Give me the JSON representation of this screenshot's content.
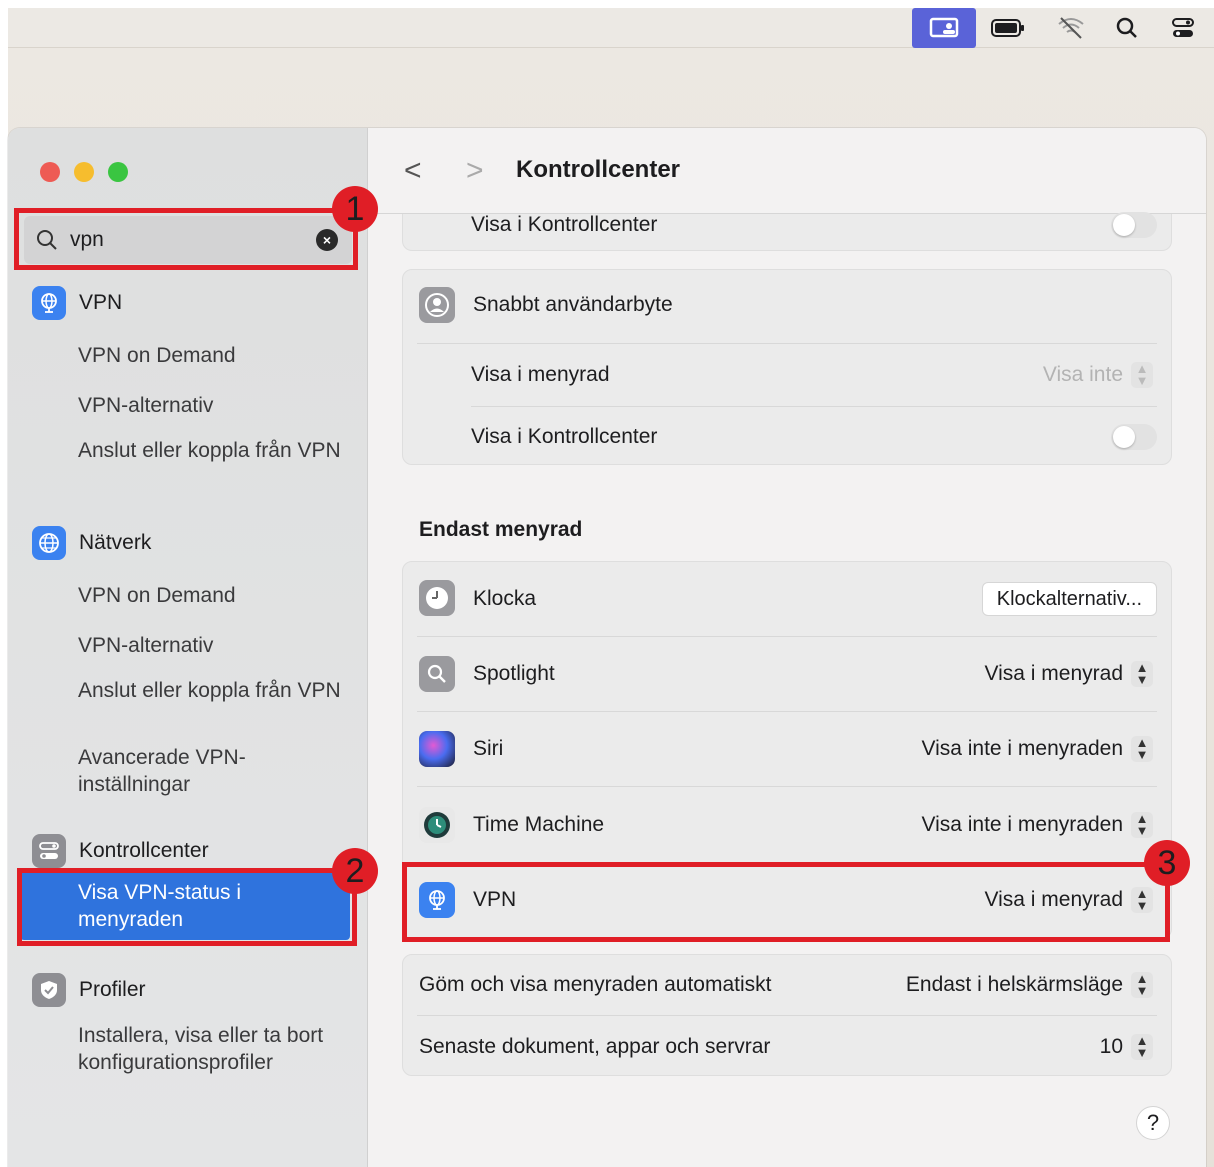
{
  "menubar": {
    "icons": [
      "screen-share-icon",
      "battery-icon",
      "wifi-off-icon",
      "search-icon",
      "control-center-icon"
    ]
  },
  "sidebar": {
    "search": {
      "value": "vpn"
    },
    "groups": [
      {
        "label": "VPN",
        "icon": "vpn-globe-icon",
        "items": [
          "VPN on Demand",
          "VPN-alternativ",
          "Anslut eller koppla från VPN"
        ]
      },
      {
        "label": "Nätverk",
        "icon": "network-globe-icon",
        "items": [
          "VPN on Demand",
          "VPN-alternativ",
          "Anslut eller koppla från VPN",
          "Avancerade VPN-inställningar"
        ]
      },
      {
        "label": "Kontrollcenter",
        "icon": "control-center-icon",
        "items": [
          "Visa VPN-status i menyraden"
        ]
      },
      {
        "label": "Profiler",
        "icon": "profiles-check-icon",
        "items": [
          "Installera, visa eller ta bort konfigurationsprofiler"
        ]
      }
    ],
    "selected_item": "Visa VPN-status i menyraden"
  },
  "annotations": [
    "1",
    "2",
    "3"
  ],
  "toolbar": {
    "back": "<",
    "forward": ">",
    "title": "Kontrollcenter"
  },
  "main": {
    "top_card": {
      "label": "Visa i Kontrollcenter",
      "toggle_on": false
    },
    "user_switch_card": {
      "title": "Snabbt användarbyte",
      "rows": [
        {
          "label": "Visa i menyrad",
          "value": "Visa inte",
          "disabled": true
        },
        {
          "label": "Visa i Kontrollcenter",
          "toggle_on": false
        }
      ]
    },
    "menubar_only_heading": "Endast menyrad",
    "menubar_only_rows": [
      {
        "label": "Klocka",
        "icon": "clock-icon",
        "button": "Klockalternativ..."
      },
      {
        "label": "Spotlight",
        "icon": "spotlight-icon",
        "value": "Visa i menyrad"
      },
      {
        "label": "Siri",
        "icon": "siri-icon",
        "value": "Visa inte i menyraden"
      },
      {
        "label": "Time Machine",
        "icon": "time-machine-icon",
        "value": "Visa inte i menyraden"
      },
      {
        "label": "VPN",
        "icon": "vpn-globe-icon",
        "value": "Visa i menyrad"
      }
    ],
    "bottom_rows": [
      {
        "label": "Göm och visa menyraden automatiskt",
        "value": "Endast i helskärmsläge"
      },
      {
        "label": "Senaste dokument, appar och servrar",
        "value": "10"
      }
    ],
    "help_label": "?"
  },
  "colors": {
    "accent": "#2f73dd",
    "annotation": "#e01e26",
    "menubar_highlight": "#5a63d8"
  }
}
